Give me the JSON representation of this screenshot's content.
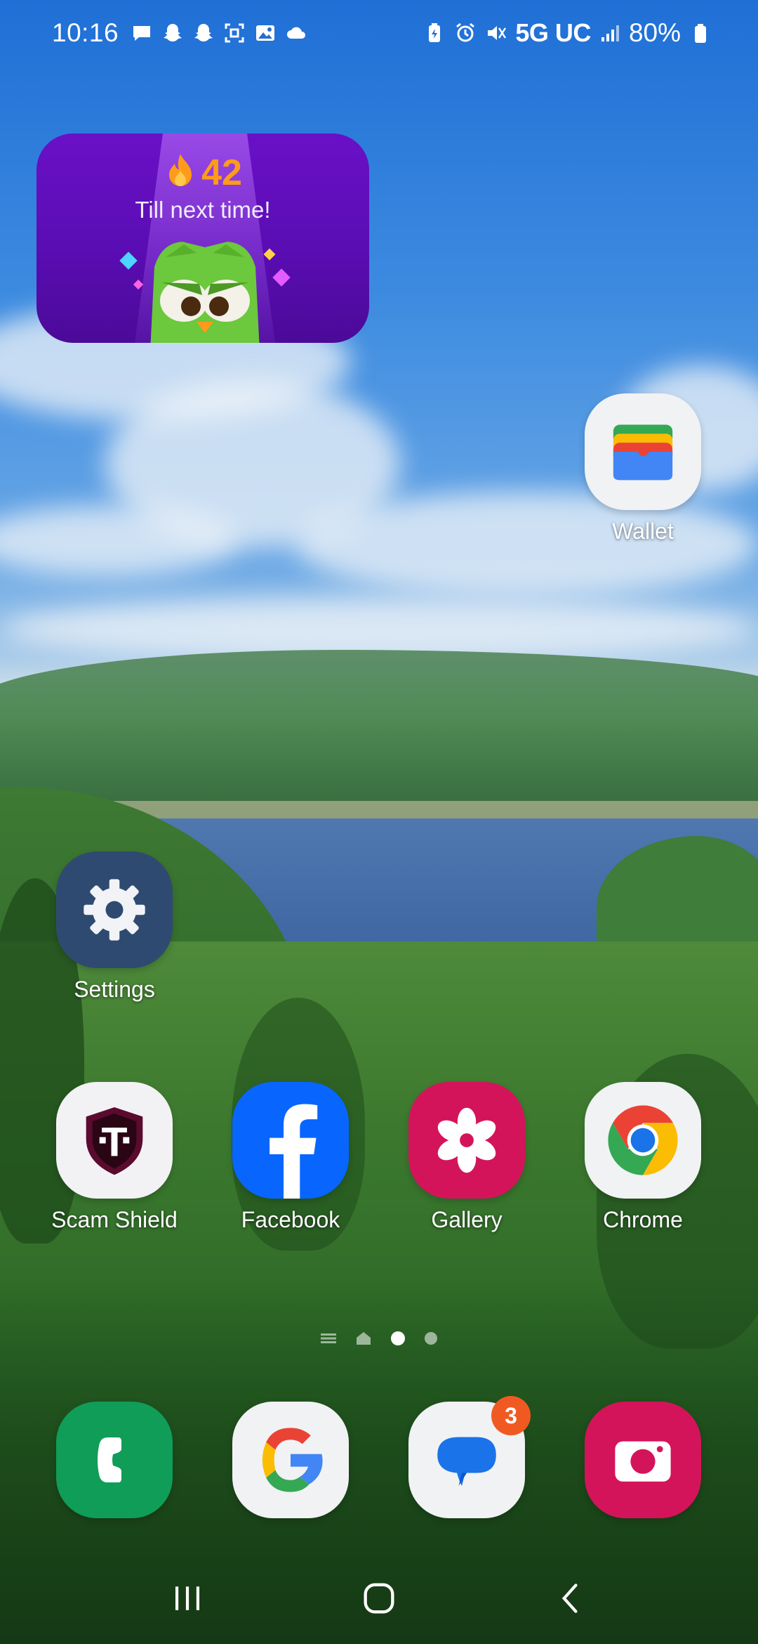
{
  "status_bar": {
    "time": "10:16",
    "left_icons": [
      "chat-bubble-icon",
      "snapchat-icon",
      "snapchat-icon",
      "screenshot-icon",
      "gallery-notification-icon",
      "cloud-icon"
    ],
    "right_icons": [
      "battery-saver-icon",
      "alarm-icon",
      "mute-icon"
    ],
    "network": "5G UC",
    "battery_percent": "80%"
  },
  "widget": {
    "app": "Duolingo",
    "streak_count": "42",
    "message": "Till next time!",
    "colors": {
      "background": "#5a0db3",
      "streak": "#ff9b1a",
      "owl": "#6cc83c"
    }
  },
  "apps": {
    "wallet": {
      "label": "Wallet",
      "icon": "wallet-icon"
    },
    "settings": {
      "label": "Settings",
      "icon": "gear-icon"
    },
    "scam_shield": {
      "label": "Scam Shield",
      "icon": "tmobile-shield-icon"
    },
    "facebook": {
      "label": "Facebook",
      "icon": "facebook-icon"
    },
    "gallery": {
      "label": "Gallery",
      "icon": "flower-icon"
    },
    "chrome": {
      "label": "Chrome",
      "icon": "chrome-icon"
    }
  },
  "dock": {
    "phone": {
      "icon": "phone-icon"
    },
    "google": {
      "icon": "google-icon"
    },
    "messages": {
      "icon": "messages-icon",
      "badge": "3"
    },
    "camera": {
      "icon": "camera-icon"
    }
  },
  "page_indicator": {
    "pages": 3,
    "active_page": 2
  },
  "nav_bar": [
    "recent-apps-icon",
    "home-icon",
    "back-icon"
  ]
}
